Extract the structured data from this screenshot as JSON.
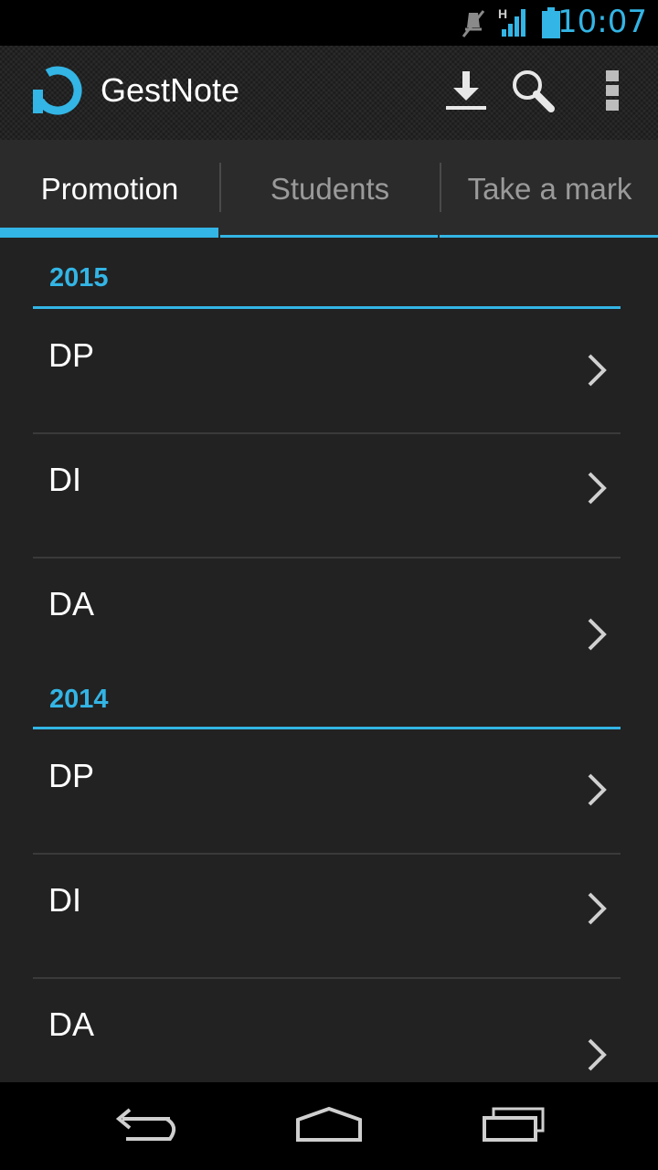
{
  "status_bar": {
    "time": "10:07",
    "network_type": "H",
    "icons": [
      "muted-icon",
      "signal-icon",
      "battery-icon"
    ]
  },
  "action_bar": {
    "app_title": "GestNote",
    "icons": [
      "app-logo-icon",
      "download-icon",
      "search-icon",
      "overflow-menu-icon"
    ]
  },
  "tabs": [
    {
      "label": "Promotion",
      "active": true
    },
    {
      "label": "Students",
      "active": false
    },
    {
      "label": "Take a mark",
      "active": false
    }
  ],
  "sections": [
    {
      "year": "2015",
      "items": [
        {
          "label": "DP"
        },
        {
          "label": "DI"
        },
        {
          "label": "DA"
        }
      ]
    },
    {
      "year": "2014",
      "items": [
        {
          "label": "DP"
        },
        {
          "label": "DI"
        },
        {
          "label": "DA"
        }
      ]
    }
  ],
  "nav_bar": {
    "icons": [
      "back-icon",
      "home-icon",
      "recent-apps-icon"
    ]
  },
  "colors": {
    "accent": "#33b5e5",
    "background": "#222222",
    "tab_background": "#2b2b2b",
    "inactive_text": "#9a9a9a"
  }
}
